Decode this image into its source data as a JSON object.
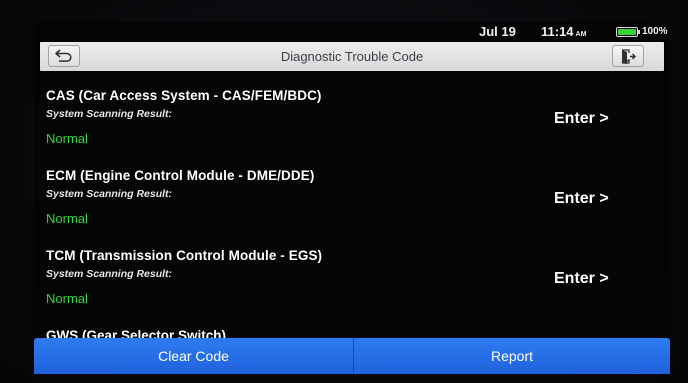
{
  "status_bar": {
    "date": "Jul 19",
    "time": "11:14",
    "ampm": "AM",
    "battery_percent": "100%",
    "battery_level": 1.0,
    "battery_color": "#39d13a"
  },
  "header": {
    "title": "Diagnostic Trouble Code",
    "back_icon": "back-arrow-icon",
    "exit_icon": "exit-icon"
  },
  "modules": [
    {
      "title": "CAS (Car Access System - CAS/FEM/BDC)",
      "subtitle": "System Scanning Result:",
      "result": "Normal",
      "action": "Enter >"
    },
    {
      "title": "ECM (Engine Control Module - DME/DDE)",
      "subtitle": "System Scanning Result:",
      "result": "Normal",
      "action": "Enter >"
    },
    {
      "title": "TCM (Transmission Control Module - EGS)",
      "subtitle": "System Scanning Result:",
      "result": "Normal",
      "action": "Enter >"
    }
  ],
  "partial_module": {
    "title": "GWS (Gear Selector Switch)"
  },
  "footer": {
    "clear_code_label": "Clear Code",
    "report_label": "Report"
  },
  "colors": {
    "result_ok": "#33d846",
    "button_blue": "#2f7bf2"
  }
}
